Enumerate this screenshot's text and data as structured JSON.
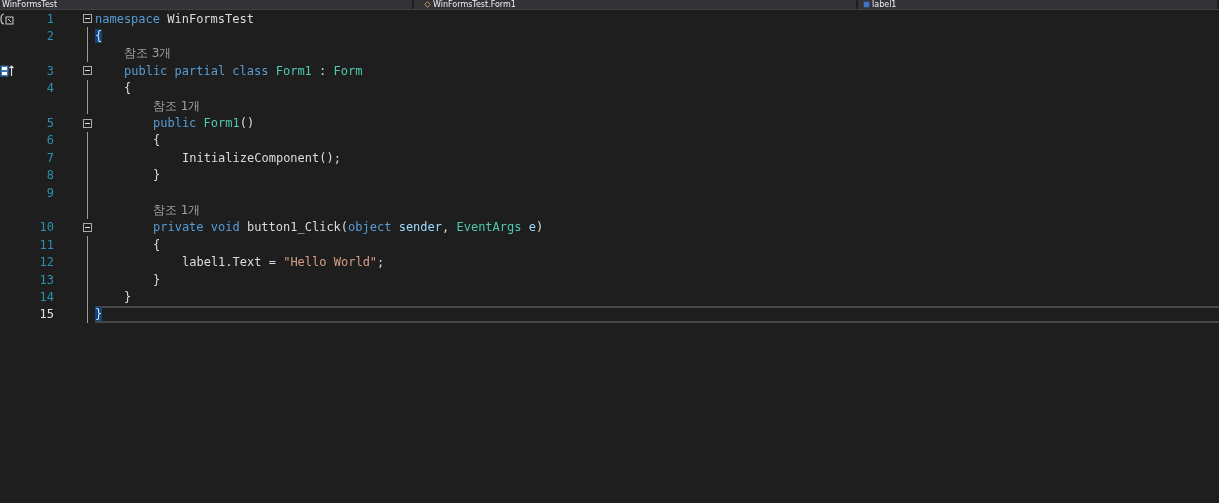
{
  "nav_bar": [
    {
      "label": "WinFormsTest"
    },
    {
      "label": "WinFormsTest.Form1"
    },
    {
      "label": "label1"
    }
  ],
  "editor": {
    "lines": [
      {
        "kind": "code",
        "number": "1",
        "foldable": true,
        "current": false,
        "tokens": [
          {
            "kind": "keyword",
            "text": "namespace "
          },
          {
            "kind": "plain",
            "text": "WinFormsTest"
          }
        ]
      },
      {
        "kind": "code",
        "number": "2",
        "foldable": false,
        "current": false,
        "tokens": [
          {
            "kind": "brace-match",
            "text": "{"
          }
        ]
      },
      {
        "kind": "codelens",
        "foldable": false,
        "current": false,
        "tokens": [
          {
            "kind": "lens",
            "text": "참조 3개"
          }
        ]
      },
      {
        "kind": "code",
        "number": "3",
        "foldable": true,
        "current": false,
        "tokens": [
          {
            "kind": "keyword",
            "text": "public partial class "
          },
          {
            "kind": "type",
            "text": "Form1"
          },
          {
            "kind": "plain",
            "text": " : "
          },
          {
            "kind": "type",
            "text": "Form"
          }
        ]
      },
      {
        "kind": "code",
        "number": "4",
        "foldable": false,
        "current": false,
        "tokens": [
          {
            "kind": "plain",
            "text": "{"
          }
        ]
      },
      {
        "kind": "codelens",
        "foldable": false,
        "current": false,
        "tokens": [
          {
            "kind": "lens",
            "text": "참조 1개"
          }
        ]
      },
      {
        "kind": "code",
        "number": "5",
        "foldable": true,
        "current": false,
        "tokens": [
          {
            "kind": "keyword",
            "text": "public "
          },
          {
            "kind": "type",
            "text": "Form1"
          },
          {
            "kind": "plain",
            "text": "()"
          }
        ]
      },
      {
        "kind": "code",
        "number": "6",
        "foldable": false,
        "current": false,
        "tokens": [
          {
            "kind": "plain",
            "text": "{"
          }
        ]
      },
      {
        "kind": "code",
        "number": "7",
        "foldable": false,
        "current": false,
        "tokens": [
          {
            "kind": "plain",
            "text": "InitializeComponent();"
          }
        ]
      },
      {
        "kind": "code",
        "number": "8",
        "foldable": false,
        "current": false,
        "tokens": [
          {
            "kind": "plain",
            "text": "}"
          }
        ]
      },
      {
        "kind": "code",
        "number": "9",
        "foldable": false,
        "current": false
      },
      {
        "kind": "codelens",
        "foldable": false,
        "current": false,
        "tokens": [
          {
            "kind": "lens",
            "text": "참조 1개"
          }
        ]
      },
      {
        "kind": "code",
        "number": "10",
        "foldable": true,
        "current": false,
        "tokens": [
          {
            "kind": "keyword",
            "text": "private void "
          },
          {
            "kind": "plain",
            "text": "button1_Click("
          },
          {
            "kind": "keyword",
            "text": "object "
          },
          {
            "kind": "param",
            "text": "sender"
          },
          {
            "kind": "plain",
            "text": ", "
          },
          {
            "kind": "type",
            "text": "EventArgs "
          },
          {
            "kind": "param",
            "text": "e"
          },
          {
            "kind": "plain",
            "text": ")"
          }
        ]
      },
      {
        "kind": "code",
        "number": "11",
        "foldable": false,
        "current": false,
        "tokens": [
          {
            "kind": "plain",
            "text": "{"
          }
        ]
      },
      {
        "kind": "code",
        "number": "12",
        "foldable": false,
        "current": false,
        "tokens": [
          {
            "kind": "plain",
            "text": "label1.Text = "
          },
          {
            "kind": "string",
            "text": "\"Hello World\""
          },
          {
            "kind": "plain",
            "text": ";"
          }
        ]
      },
      {
        "kind": "code",
        "number": "13",
        "foldable": false,
        "current": false,
        "tokens": [
          {
            "kind": "plain",
            "text": "}"
          }
        ]
      },
      {
        "kind": "code",
        "number": "14",
        "foldable": false,
        "current": false,
        "tokens": [
          {
            "kind": "plain",
            "text": "}"
          }
        ]
      },
      {
        "kind": "code",
        "number": "15",
        "foldable": false,
        "current": true,
        "tokens": [
          {
            "kind": "brace-match",
            "text": "}"
          }
        ]
      }
    ]
  }
}
